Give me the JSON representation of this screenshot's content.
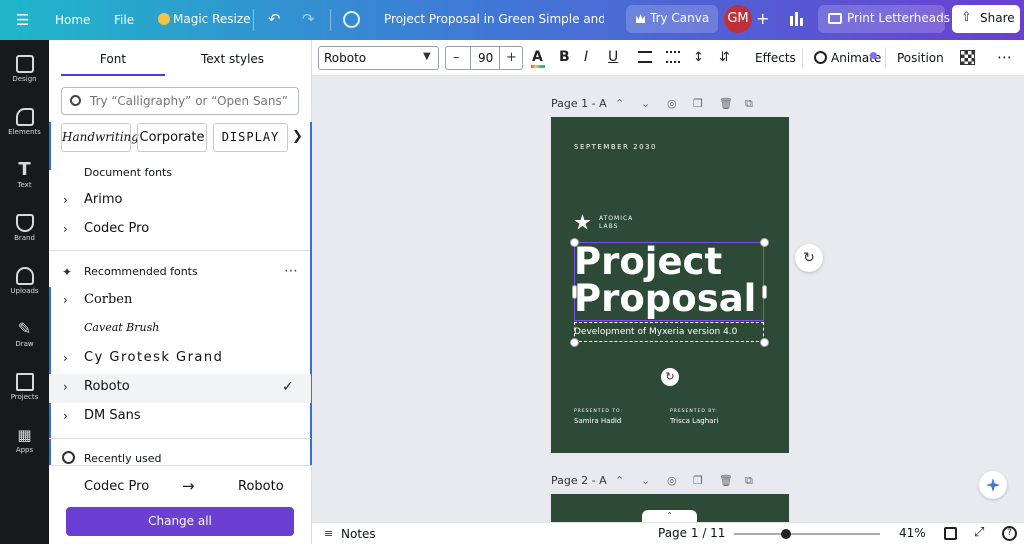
{
  "topbar": {
    "home": "Home",
    "file": "File",
    "magic_resize": "Magic Resize",
    "title": "Project Proposal in Green Simple and Mini...",
    "try_canva": "Try Canva",
    "avatar_initials": "GM",
    "print": "Print Letterheads",
    "share": "Share"
  },
  "rail": {
    "items": [
      {
        "label": "Design",
        "icon": "design-icon"
      },
      {
        "label": "Elements",
        "icon": "elements-icon"
      },
      {
        "label": "Text",
        "icon": "text-icon"
      },
      {
        "label": "Brand",
        "icon": "brand-icon"
      },
      {
        "label": "Uploads",
        "icon": "uploads-icon"
      },
      {
        "label": "Draw",
        "icon": "draw-icon"
      },
      {
        "label": "Projects",
        "icon": "projects-icon"
      },
      {
        "label": "Apps",
        "icon": "apps-icon"
      }
    ]
  },
  "panel": {
    "tab_font": "Font",
    "tab_text_styles": "Text styles",
    "search_placeholder": "Try “Calligraphy” or “Open Sans”",
    "chips": [
      "Handwriting",
      "Corporate",
      "DISPLAY"
    ],
    "document_fonts_title": "Document fonts",
    "document_fonts": [
      "Arimo",
      "Codec Pro"
    ],
    "recommended_title": "Recommended fonts",
    "recommended": [
      "Corben",
      "Caveat Brush",
      "Cy Grotesk Grand",
      "Roboto",
      "DM Sans"
    ],
    "recently_used_title": "Recently used",
    "recent_from": "Codec Pro",
    "recent_to": "Roboto",
    "change_all": "Change all"
  },
  "toolbar": {
    "font_value": "Roboto",
    "font_size": "90",
    "minus": "–",
    "plus": "+",
    "effects": "Effects",
    "animate": "Animate",
    "position": "Position"
  },
  "canvas": {
    "page1_label": "Page 1 - A...",
    "page2_label": "Page 2 - A...",
    "date": "SEPTEMBER 2030",
    "brand_line1": "ATOMICA",
    "brand_line2": "LABS",
    "title_line1": "Project",
    "title_line2": "Proposal",
    "subtitle": "Development of Myxeria version 4.0",
    "presented_to_label": "PRESENTED TO:",
    "presented_to": "Samira Hadid",
    "presented_by_label": "PRESENTED BY:",
    "presented_by": "Trisca Laghari"
  },
  "bottom": {
    "notes": "Notes",
    "page_indicator": "Page 1 / 11",
    "zoom": "41%"
  },
  "colors": {
    "accent": "#5a36d8",
    "page_bg": "#2d4a37",
    "page_text": "#ffffff",
    "selected_row": "#f2f3f5",
    "change_all_bg": "#6a3fd1"
  }
}
